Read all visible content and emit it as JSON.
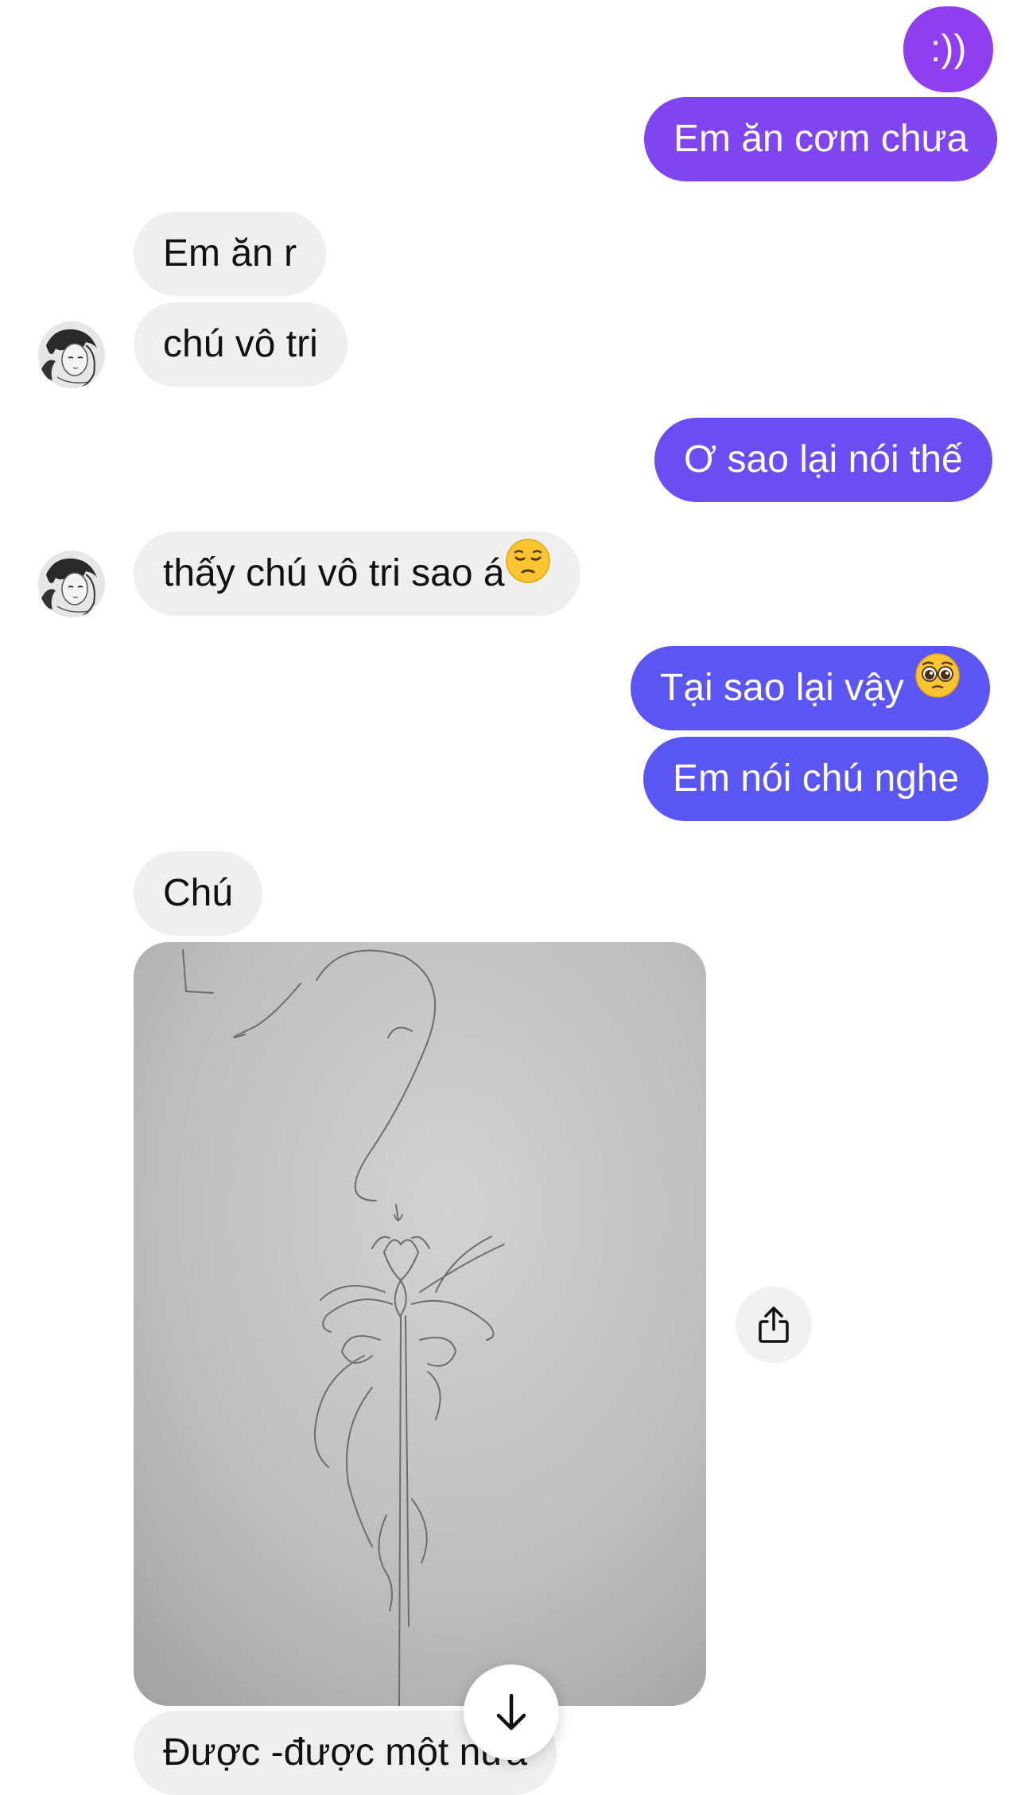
{
  "thread": {
    "messages": [
      {
        "from": "me",
        "text": ":))"
      },
      {
        "from": "me",
        "text": "Em ăn cơm chưa"
      },
      {
        "from": "them",
        "text": "Em ăn r"
      },
      {
        "from": "them",
        "text": "chú vô tri"
      },
      {
        "from": "me",
        "text": "Ơ sao lại nói thế"
      },
      {
        "from": "them",
        "text": "thấy chú vô tri sao á",
        "emoji": "😔"
      },
      {
        "from": "me",
        "text": "Tại sao lại vậy ",
        "emoji": "🥺"
      },
      {
        "from": "me",
        "text": "Em nói chú nghe"
      },
      {
        "from": "them",
        "text": "Chú"
      },
      {
        "from": "them",
        "type": "photo",
        "content": "pencil sketch"
      },
      {
        "from": "them",
        "text": "Được -được một nửa"
      }
    ]
  },
  "colors": {
    "sent_gradient": [
      "#8f3ff0",
      "#7f45f1",
      "#6b4df3",
      "#5b55f4"
    ],
    "received_bubble": "#efefef",
    "received_text": "#111111"
  },
  "icons": {
    "share": "share-icon",
    "scroll_down": "arrow-down-icon"
  }
}
